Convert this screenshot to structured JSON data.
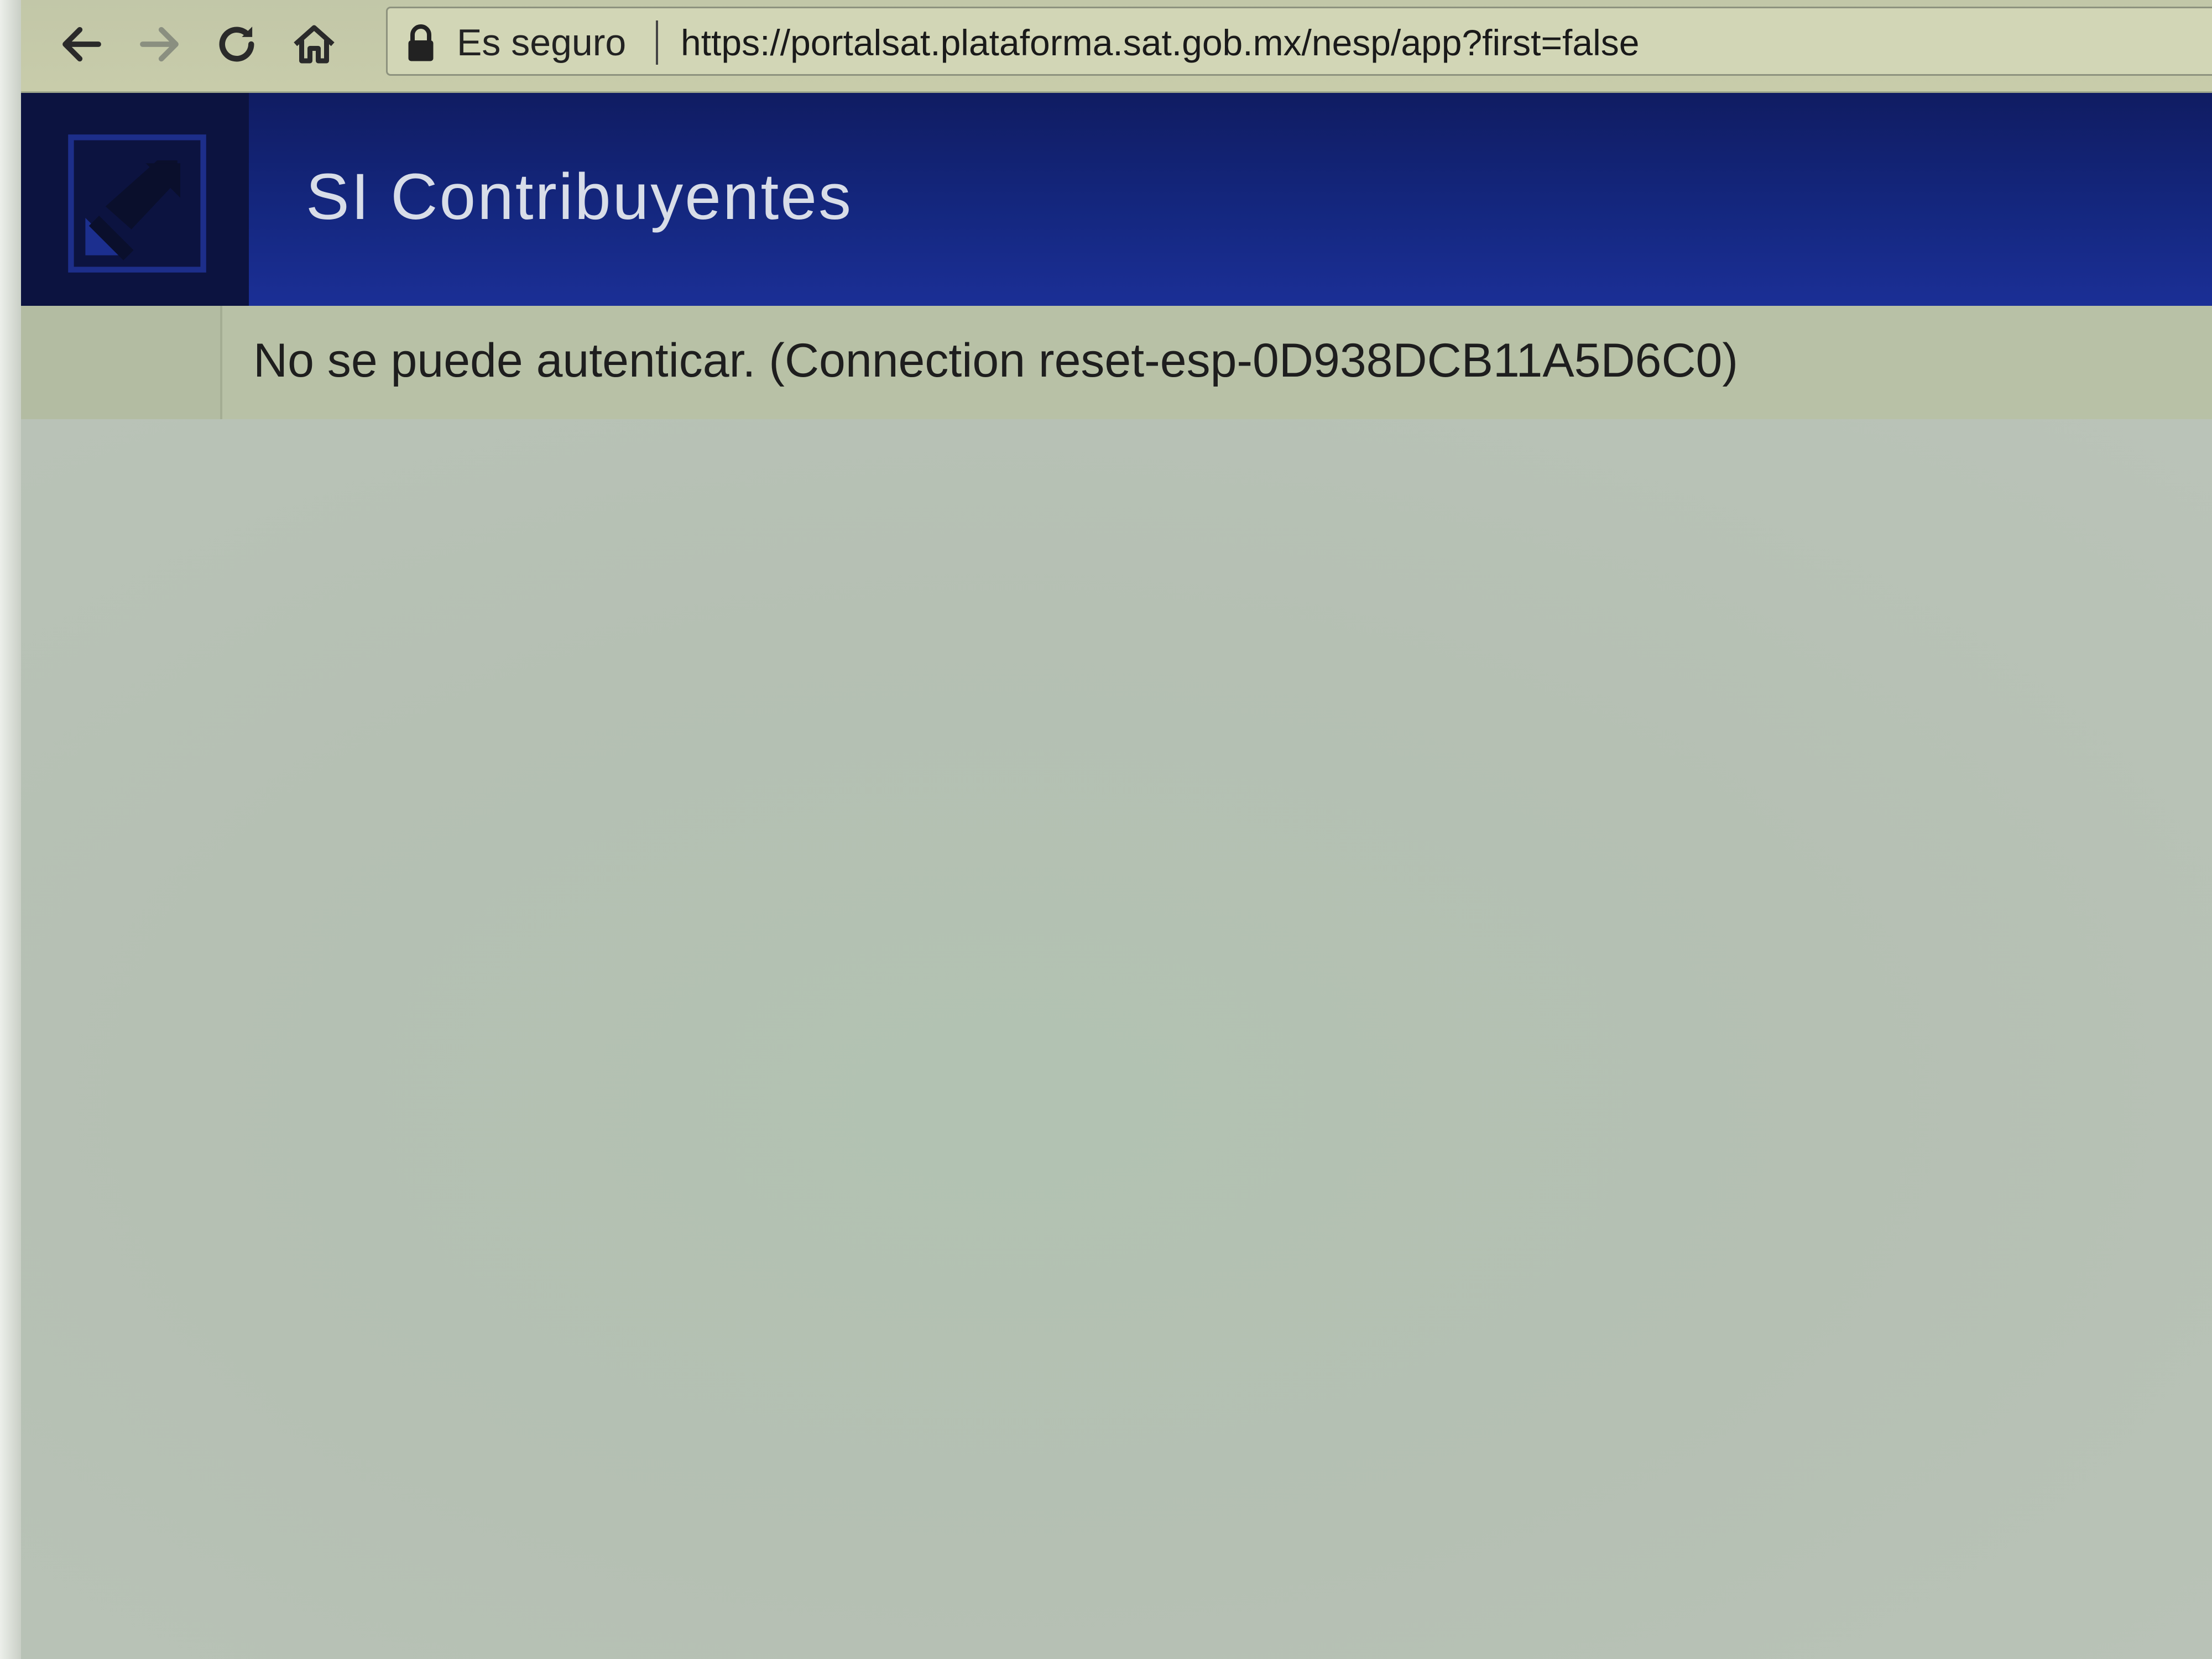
{
  "browser": {
    "back_icon": "arrow-left-icon",
    "forward_icon": "arrow-right-icon",
    "reload_icon": "reload-icon",
    "home_icon": "home-icon",
    "lock_icon": "lock-icon",
    "secure_label": "Es seguro",
    "url": "https://portalsat.plataforma.sat.gob.mx/nesp/app?first=false"
  },
  "header": {
    "logo_icon": "sat-logo-icon",
    "title": "SI Contribuyentes",
    "background_color": "#14277f"
  },
  "error": {
    "message": "No se puede autenticar. (Connection reset-esp-0D938DCB11A5D6C0)"
  }
}
